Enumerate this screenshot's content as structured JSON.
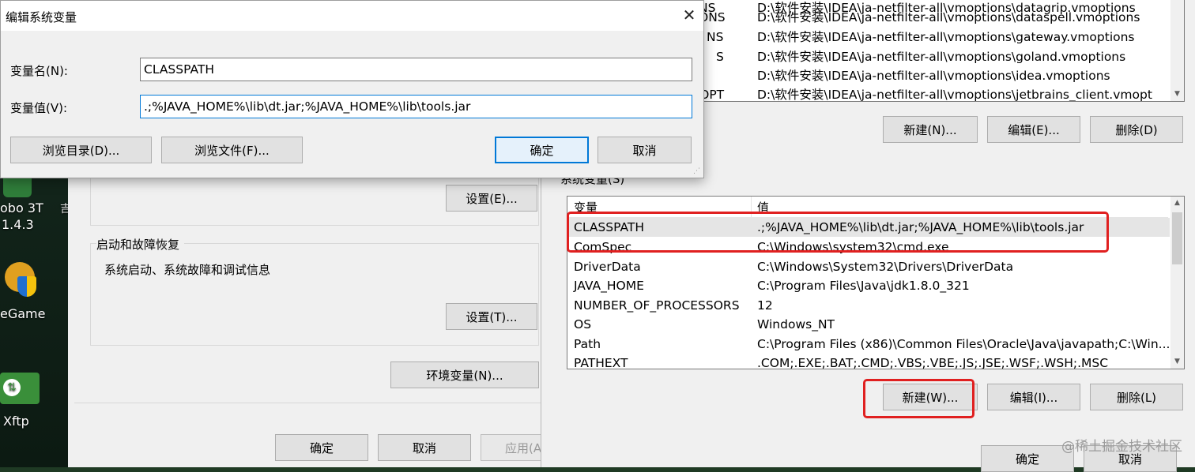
{
  "desktop": {
    "icons": [
      {
        "name": "robo3t",
        "label": "obo 3T",
        "sub": "1.4.3"
      },
      {
        "name": "wegame",
        "label": "eGame"
      },
      {
        "name": "xftp",
        "label": "Xftp"
      }
    ]
  },
  "edit_dialog": {
    "title": "编辑系统变量",
    "var_name_label": "变量名(N):",
    "var_name_value": "CLASSPATH",
    "var_value_label": "变量值(V):",
    "var_value_value": ".;%JAVA_HOME%\\lib\\dt.jar;%JAVA_HOME%\\lib\\tools.jar",
    "browse_dir": "浏览目录(D)...",
    "browse_file": "浏览文件(F)...",
    "ok": "确定",
    "cancel": "取消"
  },
  "system_properties": {
    "perf_settings_button": "设置(E)...",
    "startup_group_title": "启动和故障恢复",
    "startup_group_desc": "系统启动、系统故障和调试信息",
    "startup_settings_button": "设置(T)...",
    "env_vars_button": "环境变量(N)...",
    "ok": "确定",
    "cancel": "取消",
    "apply": "应用(A)"
  },
  "env_window": {
    "user_vars_partial": [
      {
        "name": "NS",
        "value": "D:\\软件安装\\IDEA\\ja-netfilter-all\\vmoptions\\datagrip.vmoptions"
      },
      {
        "name": "ONS",
        "value": "D:\\软件安装\\IDEA\\ja-netfilter-all\\vmoptions\\dataspell.vmoptions"
      },
      {
        "name": "NS",
        "value": "D:\\软件安装\\IDEA\\ja-netfilter-all\\vmoptions\\gateway.vmoptions"
      },
      {
        "name": "S",
        "value": "D:\\软件安装\\IDEA\\ja-netfilter-all\\vmoptions\\goland.vmoptions"
      },
      {
        "name": "",
        "value": "D:\\软件安装\\IDEA\\ja-netfilter-all\\vmoptions\\idea.vmoptions"
      },
      {
        "name": "M_OPT",
        "value": "D:\\软件安装\\IDEA\\ja-netfilter-all\\vmoptions\\jetbrains_client.vmopt"
      }
    ],
    "user_buttons": {
      "new": "新建(N)...",
      "edit": "编辑(E)...",
      "delete": "删除(D)"
    },
    "system_vars_label": "系统变量(S)",
    "columns": {
      "name": "变量",
      "value": "值"
    },
    "system_vars": [
      {
        "name": "CLASSPATH",
        "value": ".;%JAVA_HOME%\\lib\\dt.jar;%JAVA_HOME%\\lib\\tools.jar"
      },
      {
        "name": "ComSpec",
        "value": "C:\\Windows\\system32\\cmd.exe"
      },
      {
        "name": "DriverData",
        "value": "C:\\Windows\\System32\\Drivers\\DriverData"
      },
      {
        "name": "JAVA_HOME",
        "value": "C:\\Program Files\\Java\\jdk1.8.0_321"
      },
      {
        "name": "NUMBER_OF_PROCESSORS",
        "value": "12"
      },
      {
        "name": "OS",
        "value": "Windows_NT"
      },
      {
        "name": "Path",
        "value": "C:\\Program Files (x86)\\Common Files\\Oracle\\Java\\javapath;C:\\Win..."
      },
      {
        "name": "PATHEXT",
        "value": ".COM;.EXE;.BAT;.CMD;.VBS;.VBE;.JS;.JSE;.WSF;.WSH;.MSC"
      }
    ],
    "system_buttons": {
      "new": "新建(W)...",
      "edit": "编辑(I)...",
      "delete": "删除(L)"
    },
    "ok": "确定",
    "cancel": "取消"
  },
  "watermark": "@稀土掘金技术社区",
  "colors": {
    "highlight": "#e02020",
    "focus": "#0078d7"
  }
}
